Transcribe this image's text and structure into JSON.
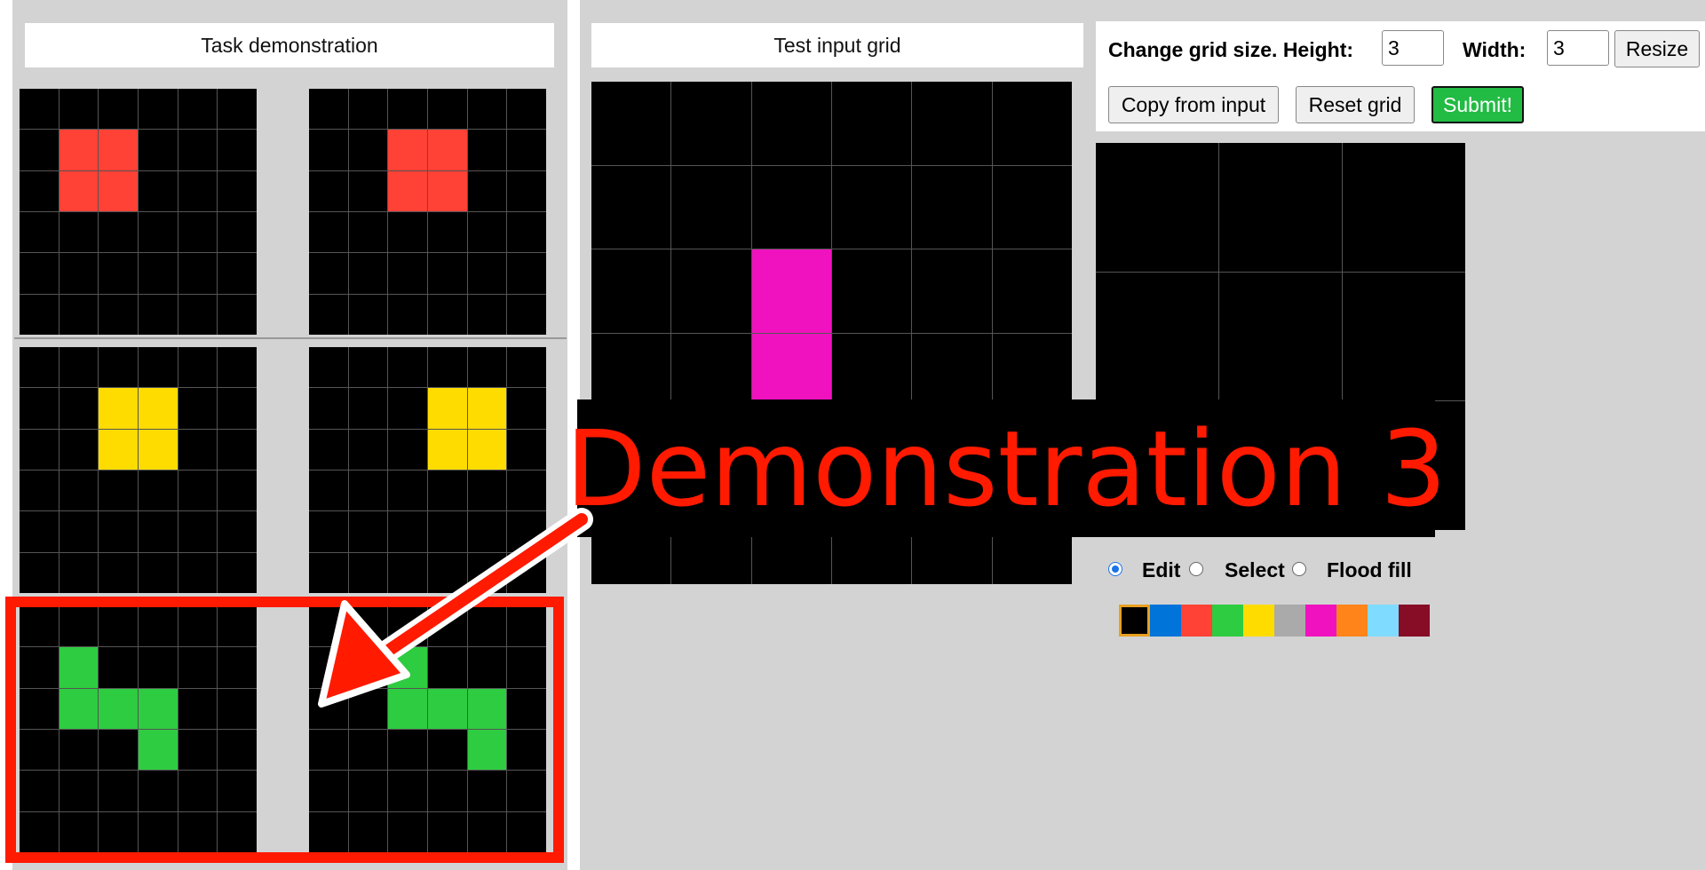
{
  "left_panel": {
    "title": "Task demonstration"
  },
  "demonstrations": [
    {
      "input": {
        "rows": 6,
        "cols": 6,
        "filled": [
          [
            1,
            1
          ],
          [
            1,
            2
          ],
          [
            2,
            1
          ],
          [
            2,
            2
          ]
        ],
        "color": "#ff4136"
      },
      "output": {
        "rows": 6,
        "cols": 6,
        "filled": [
          [
            1,
            2
          ],
          [
            1,
            3
          ],
          [
            2,
            2
          ],
          [
            2,
            3
          ]
        ],
        "color": "#ff4136"
      }
    },
    {
      "input": {
        "rows": 6,
        "cols": 6,
        "filled": [
          [
            1,
            2
          ],
          [
            1,
            3
          ],
          [
            2,
            2
          ],
          [
            2,
            3
          ]
        ],
        "color": "#ffdc00"
      },
      "output": {
        "rows": 6,
        "cols": 6,
        "filled": [
          [
            1,
            3
          ],
          [
            1,
            4
          ],
          [
            2,
            3
          ],
          [
            2,
            4
          ]
        ],
        "color": "#ffdc00"
      }
    },
    {
      "input": {
        "rows": 6,
        "cols": 6,
        "filled": [
          [
            1,
            1
          ],
          [
            2,
            1
          ],
          [
            2,
            2
          ],
          [
            2,
            3
          ],
          [
            3,
            3
          ]
        ],
        "color": "#2ecc40"
      },
      "output": {
        "rows": 6,
        "cols": 6,
        "filled": [
          [
            1,
            2
          ],
          [
            2,
            2
          ],
          [
            2,
            3
          ],
          [
            2,
            4
          ],
          [
            3,
            4
          ]
        ],
        "color": "#2ecc40"
      }
    }
  ],
  "test": {
    "title": "Test input grid",
    "grid": {
      "rows": 6,
      "cols": 6,
      "filled": [
        [
          2,
          2
        ],
        [
          3,
          2
        ]
      ],
      "color": "#f012be"
    }
  },
  "controls": {
    "change_label": "Change grid size. Height:",
    "height_value": "3",
    "width_label": "Width:",
    "width_value": "3",
    "resize_label": "Resize",
    "copy_label": "Copy from input",
    "reset_label": "Reset grid",
    "submit_label": "Submit!"
  },
  "output_grid": {
    "rows": 3,
    "cols": 3,
    "filled": [],
    "color": "#000000"
  },
  "tools": {
    "edit": "Edit",
    "select": "Select",
    "flood": "Flood fill",
    "selected": "edit"
  },
  "palette": [
    "#000000",
    "#0074d9",
    "#ff4136",
    "#2ecc40",
    "#ffdc00",
    "#aaaaaa",
    "#f012be",
    "#ff851b",
    "#7fdbff",
    "#870c25"
  ],
  "selected_color": 0,
  "overlay": {
    "text": "Demonstration 3",
    "color": "#ff1a00"
  }
}
